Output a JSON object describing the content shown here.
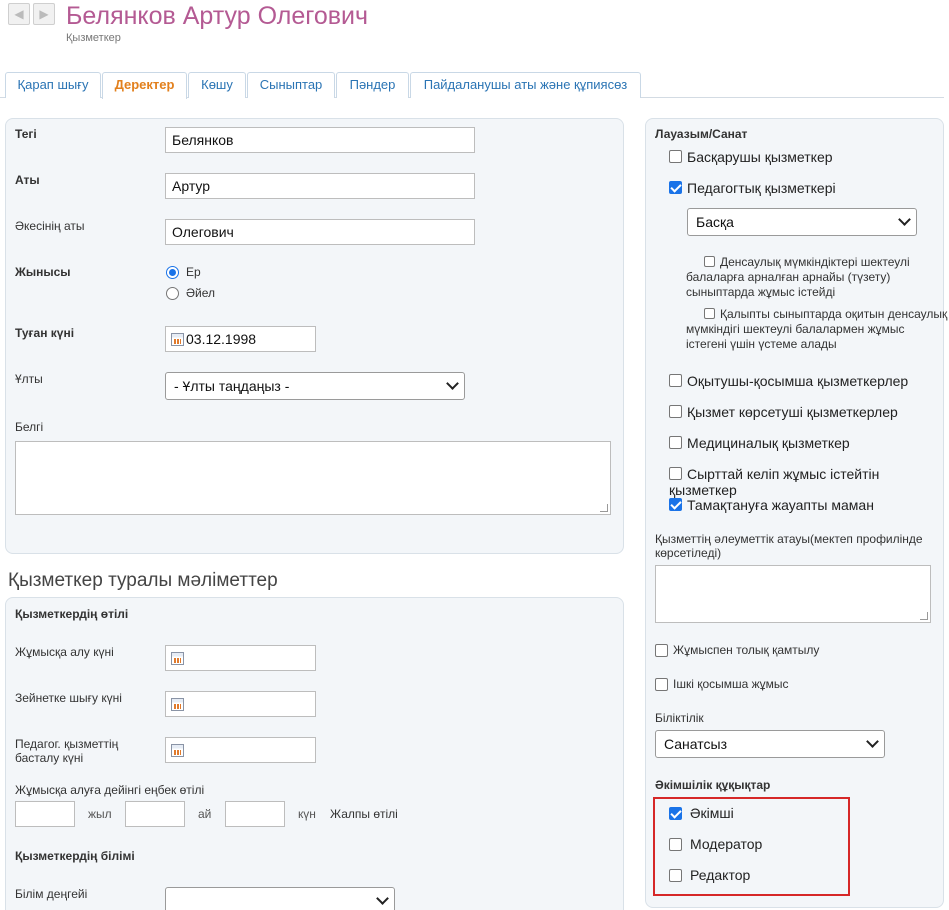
{
  "header": {
    "back_label": "◀",
    "forward_label": "▶",
    "title": "Белянков Артур Олегович",
    "subtitle": "Қызметкер"
  },
  "tabs": [
    {
      "label": "Қарап шығу",
      "active": false
    },
    {
      "label": "Деректер",
      "active": true
    },
    {
      "label": "Көшу",
      "active": false
    },
    {
      "label": "Сыныптар",
      "active": false
    },
    {
      "label": "Пәндер",
      "active": false
    },
    {
      "label": "Пайдаланушы аты және құпиясөз",
      "active": false
    }
  ],
  "personal": {
    "surname_label": "Тегі",
    "surname_value": "Белянков",
    "name_label": "Аты",
    "name_value": "Артур",
    "patronymic_label": "Әкесінің аты",
    "patronymic_value": "Олегович",
    "gender_label": "Жынысы",
    "gender_male": "Ер",
    "gender_female": "Әйел",
    "birthdate_label": "Туған күні",
    "birthdate_value": "03.12.1998",
    "nationality_label": "Ұлты",
    "nationality_value": "- Ұлты таңдаңыз -",
    "note_label": "Белгі",
    "note_value": ""
  },
  "employee_section_title": "Қызметкер туралы мәліметтер",
  "experience": {
    "heading": "Қызметкердің өтілі",
    "hire_date_label": "Жұмысқа алу күні",
    "retire_date_label": "Зейнетке шығу күні",
    "ped_start_label_1": "Педагог. қызметтің",
    "ped_start_label_2": "басталу күні",
    "prior_label": "Жұмысқа алуға дейінгі еңбек өтілі",
    "years_label": "жыл",
    "months_label": "ай",
    "days_label": "күн",
    "total_label": "Жалпы өтілі",
    "education_heading": "Қызметкердің білімі",
    "edu_level_label": "Білім деңгейі",
    "edu_level_value": ""
  },
  "position": {
    "heading": "Лауазым/Санат",
    "admin_staff": "Басқарушы қызметкер",
    "ped_staff": "Педагогтық қызметкері",
    "ped_type_value": "Басқа",
    "special_line1": "Денсаулық мүмкіндіктері шектеулі",
    "special_line2": "балаларға арналған арнайы (түзету)",
    "special_line3": "сыныптарда жұмыс істейді",
    "inclusive_line1": "Қалыпты сыныптарда оқитын денсаулық",
    "inclusive_line2": "мүмкіндігі шектеулі балалармен жұмыс",
    "inclusive_line3": "істегені үшін үстеме алады",
    "teaching_support": "Оқытушы-қосымша қызметкерлер",
    "service_staff": "Қызмет көрсетуші қызметкерлер",
    "medical_staff": "Медициналық қызметкер",
    "external_line1": "Сырттай келіп жұмыс істейтін",
    "external_line2": "қызметкер",
    "nutrition": "Тамақтануға жауапты маман",
    "social_title_line1": "Қызметтің әлеуметтік атауы(мектеп профилінде",
    "social_title_line2": "көрсетіледі)",
    "full_time": "Жұмыспен толық қамтылу",
    "internal_part": "Ішкі қосымша жұмыс",
    "qualification_label": "Біліктілік",
    "qualification_value": "Санатсыз"
  },
  "rights": {
    "heading": "Әкімшілік құқықтар",
    "admin": "Әкімші",
    "moderator": "Модератор",
    "editor": "Редактор"
  },
  "colors": {
    "title": "#b45a93",
    "tab_link": "#2a74b4",
    "tab_active": "#e2801d",
    "checkbox_on": "#1a73e8",
    "highlight_box": "#d62828"
  },
  "icons": [
    "back-arrow-icon",
    "forward-arrow-icon",
    "calendar-icon",
    "chevron-down-icon"
  ]
}
